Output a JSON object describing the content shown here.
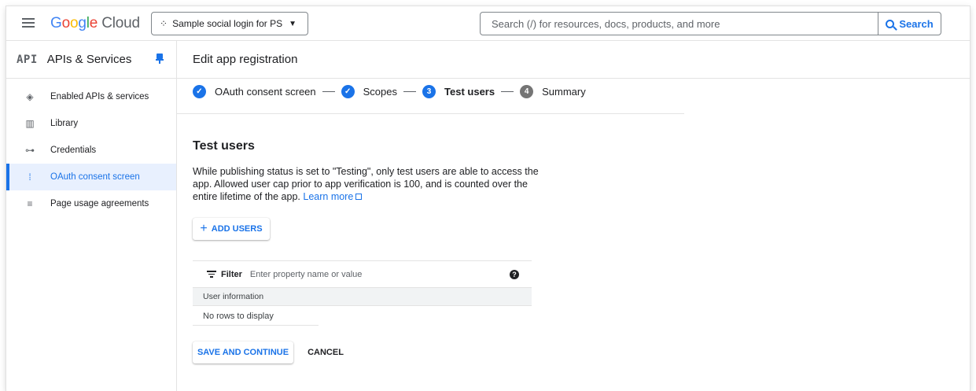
{
  "topbar": {
    "brand": {
      "g": "G",
      "o1": "o",
      "o2": "o",
      "g2": "g",
      "l": "l",
      "e": "e",
      "cloud": " Cloud"
    },
    "project_name": "Sample social login for PS",
    "search_placeholder": "Search (/) for resources, docs, products, and more",
    "search_button": "Search",
    "icons": [
      "menu-icon",
      "project-icon",
      "dropdown-caret-icon",
      "search-icon"
    ]
  },
  "sidebar": {
    "logo": "API",
    "title": "APIs & Services",
    "items": [
      {
        "label": "Enabled APIs & services",
        "icon": "api-diamond-icon",
        "glyph": "◈",
        "active": false
      },
      {
        "label": "Library",
        "icon": "library-icon",
        "glyph": "▥",
        "active": false
      },
      {
        "label": "Credentials",
        "icon": "key-icon",
        "glyph": "⊶",
        "active": false
      },
      {
        "label": "OAuth consent screen",
        "icon": "consent-icon",
        "glyph": "⁞",
        "active": true
      },
      {
        "label": "Page usage agreements",
        "icon": "settings-list-icon",
        "glyph": "≡",
        "active": false
      }
    ]
  },
  "header": {
    "title": "Edit app registration"
  },
  "stepper": {
    "steps": [
      {
        "number": "✓",
        "label": "OAuth consent screen",
        "state": "done"
      },
      {
        "number": "✓",
        "label": "Scopes",
        "state": "done"
      },
      {
        "number": "3",
        "label": "Test users",
        "state": "current"
      },
      {
        "number": "4",
        "label": "Summary",
        "state": "todo"
      }
    ]
  },
  "main": {
    "section_title": "Test users",
    "description": "While publishing status is set to \"Testing\", only test users are able to access the app. Allowed user cap prior to app verification is 100, and is counted over the entire lifetime of the app.",
    "learn_more": "Learn more",
    "add_users": "ADD USERS",
    "filter_label": "Filter",
    "filter_placeholder": "Enter property name or value",
    "help": "?",
    "table_header": "User information",
    "empty_text": "No rows to display",
    "save_button": "SAVE AND CONTINUE",
    "cancel_button": "CANCEL"
  },
  "colors": {
    "accent": "#1a73e8",
    "text": "#202124",
    "muted": "#5f6368",
    "active_bg": "#e8f0fe"
  }
}
